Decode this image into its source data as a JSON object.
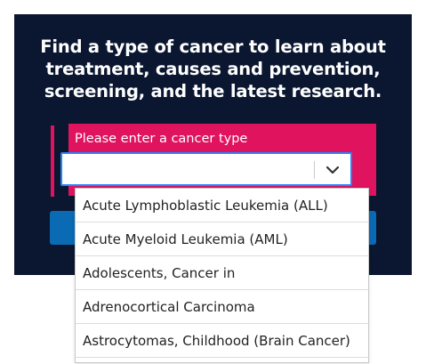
{
  "hero": {
    "headline_line1": "Find a type of cancer to learn about",
    "headline_line2": "treatment, causes and prevention,",
    "headline_line3": "screening, and the latest research."
  },
  "search": {
    "label": "Please enter a cancer type",
    "value": "",
    "indicator_icon": "chevron-down-icon"
  },
  "dropdown": {
    "options": [
      "Acute Lymphoblastic Leukemia (ALL)",
      "Acute Myeloid Leukemia (AML)",
      "Adolescents, Cancer in",
      "Adrenocortical Carcinoma",
      "Astrocytomas, Childhood (Brain Cancer)"
    ]
  },
  "colors": {
    "panel_background": "#0b1730",
    "accent_pink": "#e0135e",
    "focus_blue": "#2684ff",
    "button_blue": "#0a6ab4"
  }
}
